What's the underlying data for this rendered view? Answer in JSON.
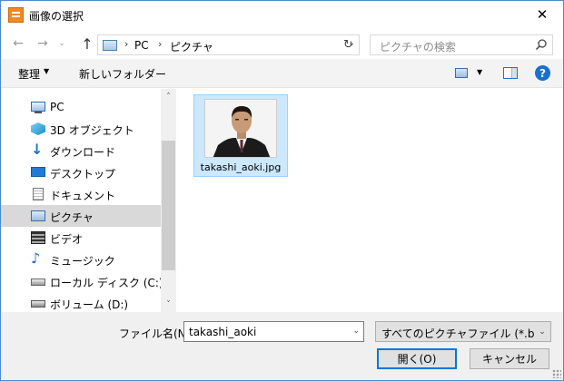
{
  "window": {
    "title": "画像の選択",
    "close_glyph": "✕"
  },
  "nav": {
    "back": "←",
    "forward": "→",
    "recent": "⌄",
    "up": "↑",
    "address": {
      "sep": "›",
      "pc": "PC",
      "pictures": "ピクチャ",
      "dropdown": "⌄"
    },
    "refresh": "↻",
    "search_placeholder": "ピクチャの検索"
  },
  "toolbar": {
    "organize": "整理",
    "organize_arrow": "▼",
    "new_folder": "新しいフォルダー",
    "view_arrow": "▼",
    "help": "?"
  },
  "sidebar": {
    "items": [
      {
        "label": "PC",
        "icon": "pc-icon"
      },
      {
        "label": "3D オブジェクト",
        "icon": "3d-objects-icon"
      },
      {
        "label": "ダウンロード",
        "icon": "download-icon"
      },
      {
        "label": "デスクトップ",
        "icon": "desktop-icon"
      },
      {
        "label": "ドキュメント",
        "icon": "document-icon"
      },
      {
        "label": "ピクチャ",
        "icon": "pictures-icon",
        "selected": true
      },
      {
        "label": "ビデオ",
        "icon": "video-icon"
      },
      {
        "label": "ミュージック",
        "icon": "music-icon"
      },
      {
        "label": "ローカル ディスク (C:)",
        "icon": "local-disk-icon"
      },
      {
        "label": "ボリューム (D:)",
        "icon": "volume-icon"
      }
    ],
    "scroll_up": "˄",
    "scroll_down": "˅"
  },
  "files": [
    {
      "name": "takashi_aoki.jpg",
      "selected": true
    }
  ],
  "bottom": {
    "filename_label": "ファイル名(N):",
    "filename_value": "takashi_aoki",
    "filename_dropdown": "⌄",
    "filetype": "すべてのピクチャファイル (*.bmp;*.JI",
    "filetype_dropdown": "⌄",
    "open": "開く(O)",
    "cancel": "キャンセル"
  },
  "colors": {
    "accent": "#0078d7",
    "selection_bg": "#cce8ff",
    "selection_border": "#99d1ff",
    "app_icon": "#f08a24"
  }
}
